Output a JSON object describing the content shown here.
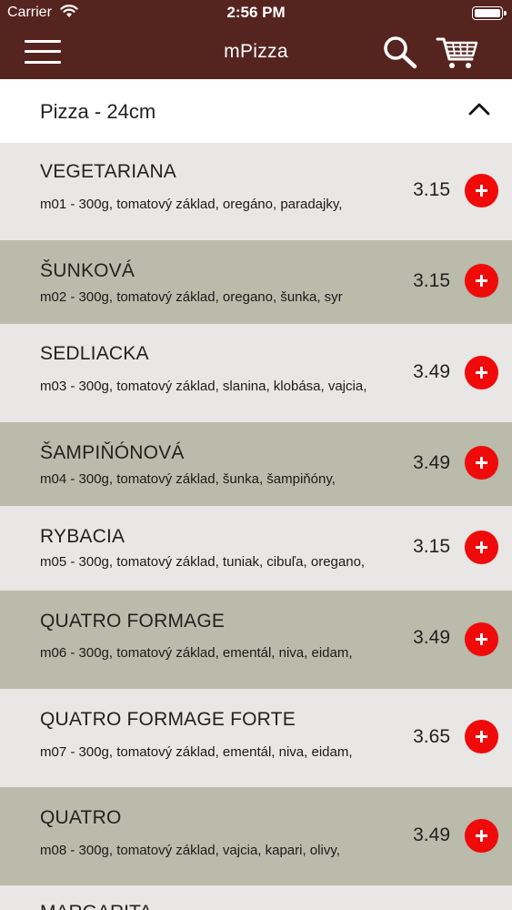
{
  "status_bar": {
    "carrier": "Carrier",
    "time": "2:56 PM"
  },
  "nav": {
    "title": "mPizza",
    "menu_icon": "hamburger-menu-icon",
    "search_icon": "search-icon",
    "cart_icon": "shopping-cart-icon"
  },
  "category": {
    "title": "Pizza - 24cm",
    "toggle_icon": "chevron-up-icon"
  },
  "items": [
    {
      "name": "VEGETARIANA",
      "desc": "m01 - 300g, tomatový základ, oregáno, paradajky,",
      "price": "3.15"
    },
    {
      "name": "ŠUNKOVÁ",
      "desc": "m02 - 300g, tomatový základ, oregano, šunka, syr",
      "price": "3.15"
    },
    {
      "name": "SEDLIACKA",
      "desc": "m03 - 300g, tomatový základ, slanina, klobása, vajcia,",
      "price": "3.49"
    },
    {
      "name": "ŠAMPIŇÓNOVÁ",
      "desc": "m04 - 300g, tomatový základ, šunka, šampiňóny,",
      "price": "3.49"
    },
    {
      "name": "RYBACIA",
      "desc": "m05 - 300g, tomatový základ, tuniak, cibuľa, oregano,",
      "price": "3.15"
    },
    {
      "name": "QUATRO FORMAGE",
      "desc": "m06 - 300g, tomatový základ, ementál, niva, eidam,",
      "price": "3.49"
    },
    {
      "name": "QUATRO FORMAGE FORTE",
      "desc": "m07 - 300g, tomatový základ, ementál, niva, eidam,",
      "price": "3.65"
    },
    {
      "name": "QUATRO",
      "desc": "m08 - 300g, tomatový základ, vajcia, kapari, olivy,",
      "price": "3.49"
    }
  ],
  "partial_item": {
    "name": "MARGARITA"
  },
  "colors": {
    "header_bg": "#55241f",
    "row_light": "#e8e7e5",
    "row_dark": "#bbbbab",
    "add_button": "#f00a0a"
  }
}
